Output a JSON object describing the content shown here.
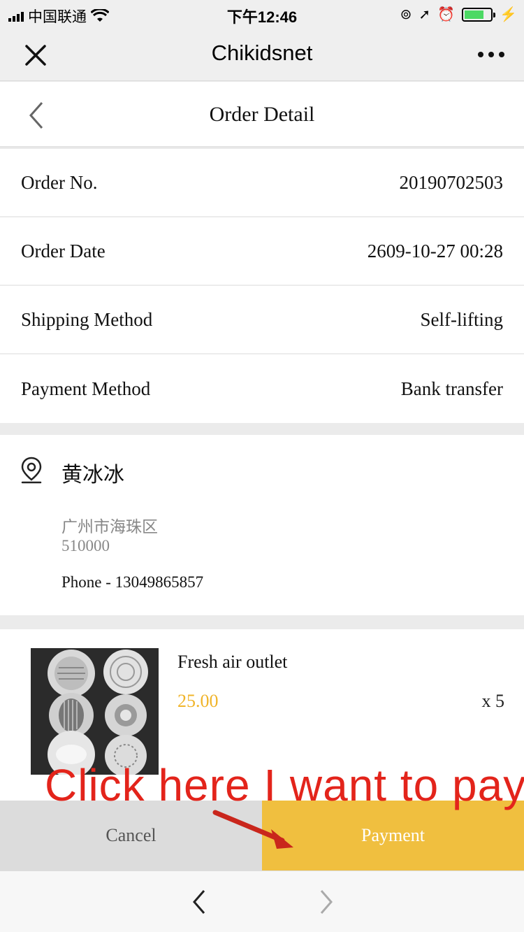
{
  "status_bar": {
    "carrier": "中国联通",
    "time": "下午12:46"
  },
  "nav": {
    "title": "Chikidsnet",
    "close_icon": "close-icon",
    "more_icon": "more-icon"
  },
  "page": {
    "title": "Order Detail",
    "back_icon": "chevron-left-icon"
  },
  "order_info": [
    {
      "label": "Order No.",
      "value": "20190702503"
    },
    {
      "label": "Order Date",
      "value": "2609-10-27 00:28"
    },
    {
      "label": "Shipping Method",
      "value": "Self-lifting"
    },
    {
      "label": "Payment Method",
      "value": "Bank transfer"
    }
  ],
  "address": {
    "icon": "location-pin-icon",
    "name": "黄冰冰",
    "line": "广州市海珠区",
    "zip": "510000",
    "phone": "Phone - 13049865857"
  },
  "product": {
    "name": "Fresh air outlet",
    "price": "25.00",
    "quantity": "x 5",
    "price_color": "#f0b429"
  },
  "actions": {
    "cancel": "Cancel",
    "payment": "Payment",
    "payment_color": "#f0bf3f"
  },
  "annotation": {
    "text": "Click here I want to pay",
    "color": "#e3241b"
  },
  "browser_nav": {
    "back_icon": "chevron-left-icon",
    "forward_icon": "chevron-right-icon"
  }
}
